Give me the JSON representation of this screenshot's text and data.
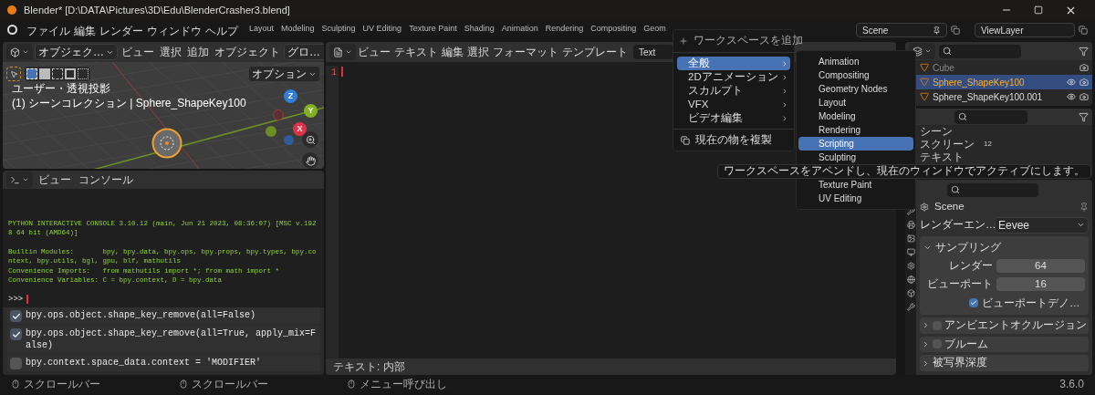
{
  "window": {
    "title": "Blender* [D:\\DATA\\Pictures\\3D\\Edu\\BlenderCrasher3.blend]"
  },
  "menubar": {
    "menus": [
      "ファイル",
      "編集",
      "レンダー",
      "ウィンドウ",
      "ヘルプ"
    ],
    "workspace_tabs": [
      "Layout",
      "Modeling",
      "Sculpting",
      "UV Editing",
      "Texture Paint",
      "Shading",
      "Animation",
      "Rendering",
      "Compositing",
      "Geom"
    ]
  },
  "scene_field": {
    "value": "Scene"
  },
  "view_layer_field": {
    "value": "ViewLayer"
  },
  "viewport": {
    "mode": "オブジェク…",
    "menus": [
      "ビュー",
      "選択",
      "追加",
      "オブジェクト"
    ],
    "orientation": "グロ…",
    "options": "オプション",
    "overlay_lines": [
      "ユーザー・透視投影",
      "(1) シーンコレクション | Sphere_ShapeKey100"
    ],
    "gizmo_axes": [
      "Z",
      "Y",
      "X"
    ]
  },
  "console": {
    "menus": [
      "ビュー",
      "コンソール"
    ],
    "blocks": [
      [
        "PYTHON INTERACTIVE CONSOLE 3.10.12 (main, Jun 21 2023, 08:36:07) [MSC v.192",
        "8 64 bit (AMD64)]"
      ],
      [
        "Builtin Modules:       bpy, bpy.data, bpy.ops, bpy.props, bpy.types, bpy.co",
        "ntext, bpy.utils, bgl, gpu, blf, mathutils",
        "Convenience Imports:   from mathutils import *; from math import *",
        "Convenience Variables: C = bpy.context, D = bpy.data"
      ]
    ],
    "prompt": ">>>"
  },
  "info_log": [
    {
      "text": "bpy.ops.object.shape_key_remove(all=False)",
      "checked": true
    },
    {
      "text": "bpy.ops.object.shape_key_remove(all=True, apply_mix=F\nalse)",
      "checked": true
    },
    {
      "text": "bpy.context.space_data.context = 'MODIFIER'",
      "checked": false
    }
  ],
  "text_editor": {
    "menus": [
      "ビュー",
      "テキスト",
      "編集",
      "選択",
      "フォーマット",
      "テンプレート"
    ],
    "text_name": "Text",
    "line_numbers": [
      "1"
    ],
    "footer": "テキスト: 内部"
  },
  "workspace_menu": {
    "title": "ワークスペースを追加",
    "items": [
      {
        "label": "全般",
        "selected": true
      },
      {
        "label": "2Dアニメーション",
        "selected": false
      },
      {
        "label": "スカルプト",
        "selected": false
      },
      {
        "label": "VFX",
        "selected": false
      },
      {
        "label": "ビデオ編集",
        "selected": false
      }
    ],
    "duplicate": "現在の物を複製"
  },
  "submenu": {
    "items": [
      {
        "label": "Animation",
        "selected": false
      },
      {
        "label": "Compositing",
        "selected": false
      },
      {
        "label": "Geometry Nodes",
        "selected": false
      },
      {
        "label": "Layout",
        "selected": false
      },
      {
        "label": "Modeling",
        "selected": false
      },
      {
        "label": "Rendering",
        "selected": false
      },
      {
        "label": "Scripting",
        "selected": true
      },
      {
        "label": "Sculpting",
        "selected": false
      }
    ],
    "lower_items": [
      {
        "label": "Texture Paint",
        "selected": false
      },
      {
        "label": "UV Editing",
        "selected": false
      }
    ]
  },
  "tooltip": "ワークスペースをアペンドし、現在のウィンドウでアクティブにします。",
  "outliner": {
    "rows": [
      {
        "label": "Cube",
        "selected": false,
        "disabled": true
      },
      {
        "label": "Sphere_ShapeKey100",
        "selected": true,
        "disabled": false
      },
      {
        "label": "Sphere_ShapeKey100.001",
        "selected": false,
        "disabled": false
      }
    ]
  },
  "data_outliner": {
    "rows": [
      {
        "label": "シーン"
      },
      {
        "label": "スクリーン",
        "count": "12"
      },
      {
        "label": "テキスト"
      }
    ]
  },
  "properties": {
    "scene": "Scene",
    "engine_label": "レンダーエン…",
    "engine": "Eevee",
    "sampling": {
      "title": "サンプリング",
      "expanded": true,
      "fields": [
        {
          "label": "レンダー",
          "value": "64"
        },
        {
          "label": "ビューポート",
          "value": "16"
        }
      ],
      "denoise": {
        "label": "ビューポートデノ…",
        "checked": true
      }
    },
    "panels": [
      {
        "title": "アンビエントオクルージョン",
        "has_checkbox": true,
        "checked": false
      },
      {
        "title": "ブルーム",
        "has_checkbox": true,
        "checked": false
      },
      {
        "title": "被写界深度",
        "has_checkbox": false
      }
    ]
  },
  "status_bar": {
    "items": [
      "スクロールバー",
      "スクロールバー",
      "メニュー呼び出し"
    ],
    "version": "3.6.0"
  }
}
